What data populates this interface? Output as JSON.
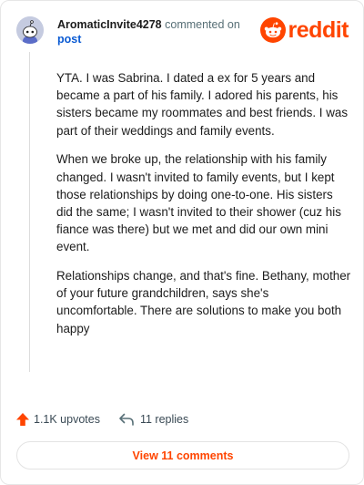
{
  "comment": {
    "username": "AromaticInvite4278",
    "action_text": "commented on",
    "post_link": "post",
    "paragraphs": [
      "YTA. I was Sabrina. I dated a ex for 5 years and became a part of his family. I adored his parents, his sisters became my roommates and best friends. I was part of their weddings and family events.",
      "When we broke up, the relationship with his family changed. I wasn't invited to family events, but I kept those relationships by doing one-to-one. His sisters did the same; I wasn't invited to their shower (cuz his fiance was there) but we met and did our own mini event.",
      "Relationships change, and that's fine. Bethany, mother of your future grandchildren, says she's uncomfortable. There are solutions to make you both happy"
    ]
  },
  "brand": {
    "name": "reddit",
    "color": "#ff4500"
  },
  "actions": {
    "upvotes": "1.1K upvotes",
    "replies": "11 replies"
  },
  "footer": {
    "view_comments": "View 11 comments"
  },
  "icons": {
    "avatar": "snoo-avatar-icon",
    "logo": "reddit-alien-icon",
    "upvote": "upvote-arrow-icon",
    "reply": "reply-arrow-icon"
  }
}
